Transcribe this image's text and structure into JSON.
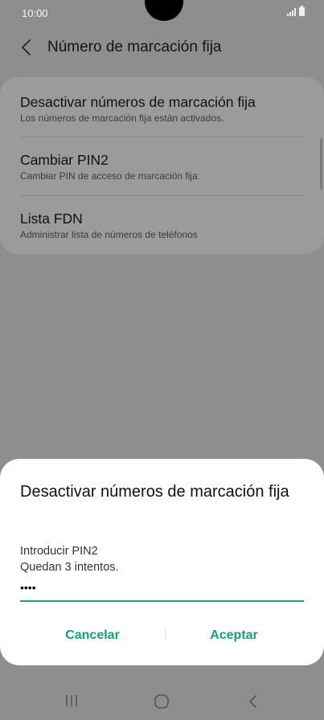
{
  "status": {
    "time": "10:00"
  },
  "appbar": {
    "title": "Número de marcación fija"
  },
  "settings": {
    "items": [
      {
        "title": "Desactivar números de marcación fija",
        "subtitle": "Los números de marcación fija están activados."
      },
      {
        "title": "Cambiar PIN2",
        "subtitle": "Cambiar PIN de acceso de marcación fija"
      },
      {
        "title": "Lista FDN",
        "subtitle": "Administrar lista de números de teléfonos"
      }
    ]
  },
  "dialog": {
    "title": "Desactivar números de marcación fija",
    "message_line1": "Introducir PIN2",
    "message_line2": "Quedan 3 intentos.",
    "pin_value": "••••",
    "cancel_label": "Cancelar",
    "accept_label": "Aceptar",
    "accent_color": "#15a076"
  },
  "icons": {
    "back": "back-arrow-icon",
    "nav_recent": "recent-apps-icon",
    "nav_home": "home-icon",
    "nav_back": "nav-back-icon"
  }
}
